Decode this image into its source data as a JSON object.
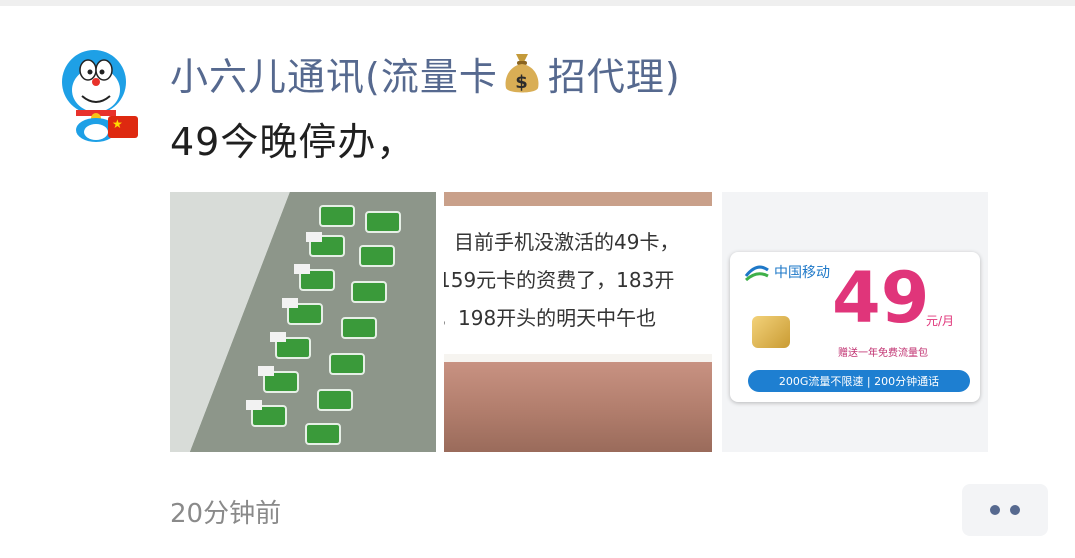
{
  "post": {
    "author_name_prefix": "小六儿通讯(流量卡",
    "author_name_suffix": "招代理)",
    "author_icon": "money-bag-icon",
    "text": "49今晚停办，",
    "time": "20分钟前"
  },
  "images": [
    {
      "subject": "sim-cards-in-bags"
    },
    {
      "lines": [
        "目前手机没激活的49卡，",
        "159元卡的资费了，183开",
        "，198开头的明天中午也"
      ]
    },
    {
      "carrier": "中国移动",
      "price": "49",
      "unit": "元/月",
      "subtitle": "赠送一年免费流量包",
      "banner": "200G流量不限速 | 200分钟通话"
    }
  ],
  "colors": {
    "name": "#56698f",
    "price": "#e0357a",
    "banner": "#1e7fd1"
  }
}
